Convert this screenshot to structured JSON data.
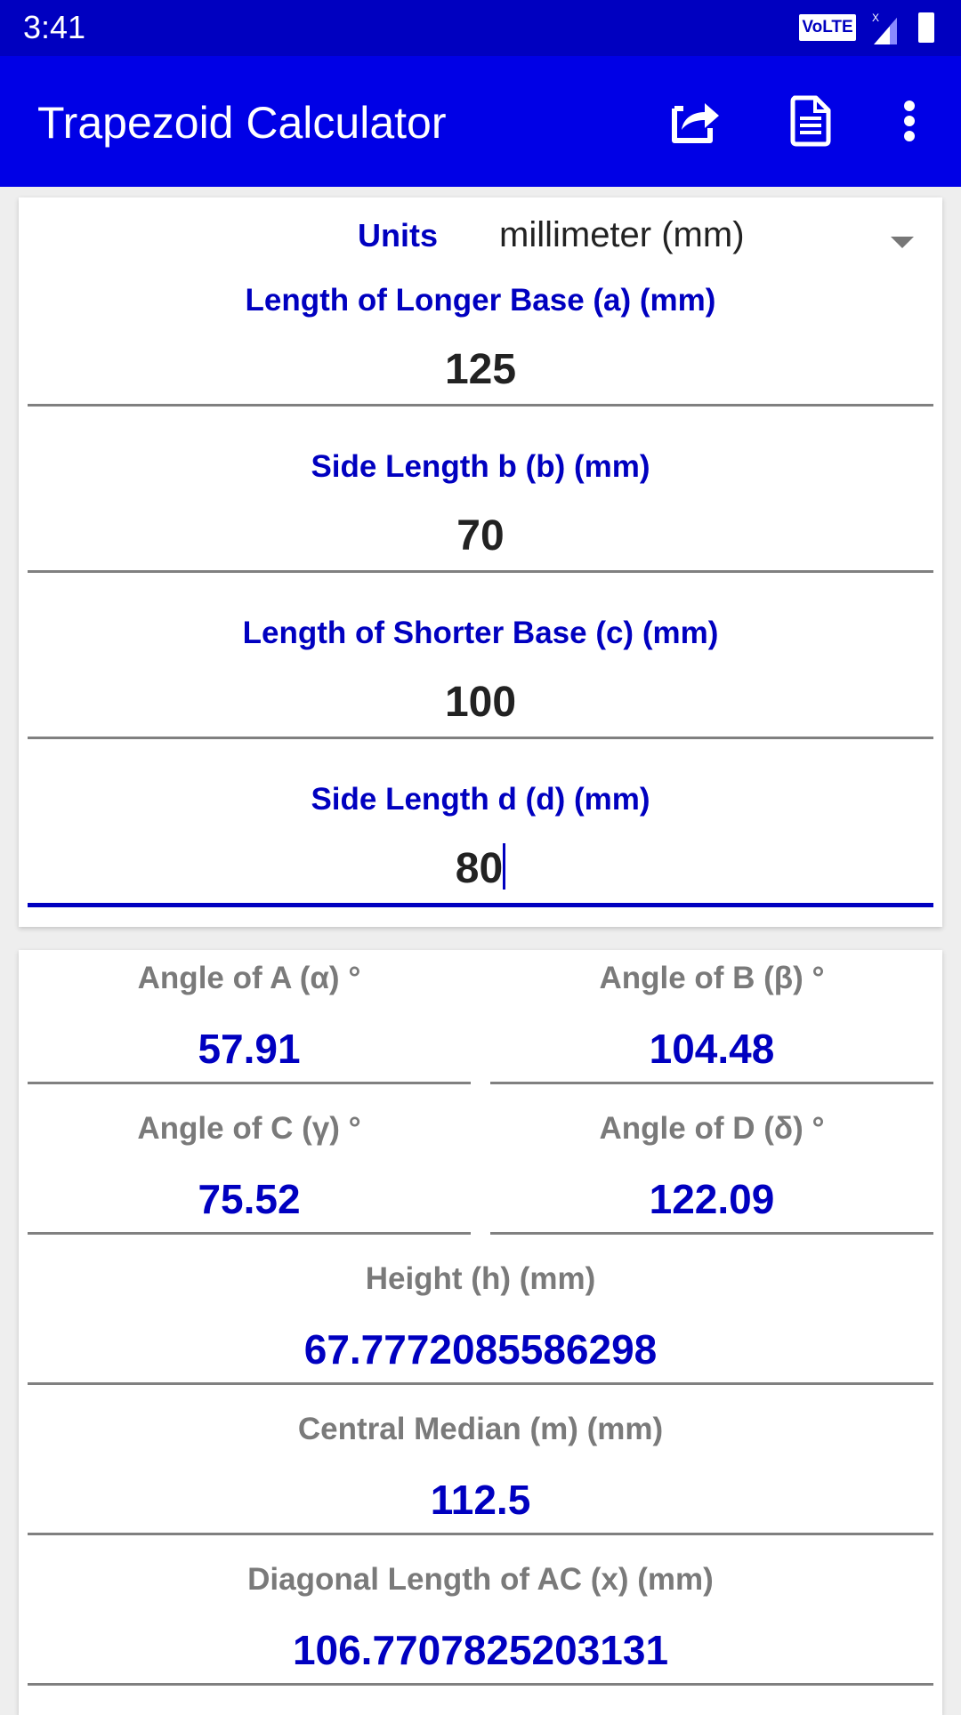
{
  "status_bar": {
    "time": "3:41",
    "volte_badge": "VoLTE",
    "signal_indicator": "x"
  },
  "app_bar": {
    "title": "Trapezoid Calculator",
    "actions": [
      {
        "name": "share",
        "icon": "share-icon"
      },
      {
        "name": "document",
        "icon": "document-icon"
      },
      {
        "name": "more",
        "icon": "more-vert-icon"
      }
    ]
  },
  "colors": {
    "primary": "#0000e6",
    "status_bar": "#0000c0",
    "accent_text": "#0000c0",
    "output_label": "#7a7a7a"
  },
  "inputs": {
    "units_label": "Units",
    "units_value": "millimeter (mm)",
    "fields": [
      {
        "label": "Length of Longer Base (a) (mm)",
        "value": "125"
      },
      {
        "label": "Side Length b (b) (mm)",
        "value": "70"
      },
      {
        "label": "Length of Shorter Base (c) (mm)",
        "value": "100"
      },
      {
        "label": "Side Length d (d) (mm)",
        "value": "80"
      }
    ]
  },
  "results": {
    "angles": [
      {
        "label": "Angle of A (α) °",
        "value": "57.91"
      },
      {
        "label": "Angle of B (β) °",
        "value": "104.48"
      },
      {
        "label": "Angle of C (γ) °",
        "value": "75.52"
      },
      {
        "label": "Angle of D (δ) °",
        "value": "122.09"
      }
    ],
    "height": {
      "label": "Height (h) (mm)",
      "value": "67.7772085586298"
    },
    "median": {
      "label": "Central Median (m) (mm)",
      "value": "112.5"
    },
    "diagonal_ac": {
      "label": "Diagonal Length of AC (x) (mm)",
      "value": "106.7707825203131"
    }
  }
}
